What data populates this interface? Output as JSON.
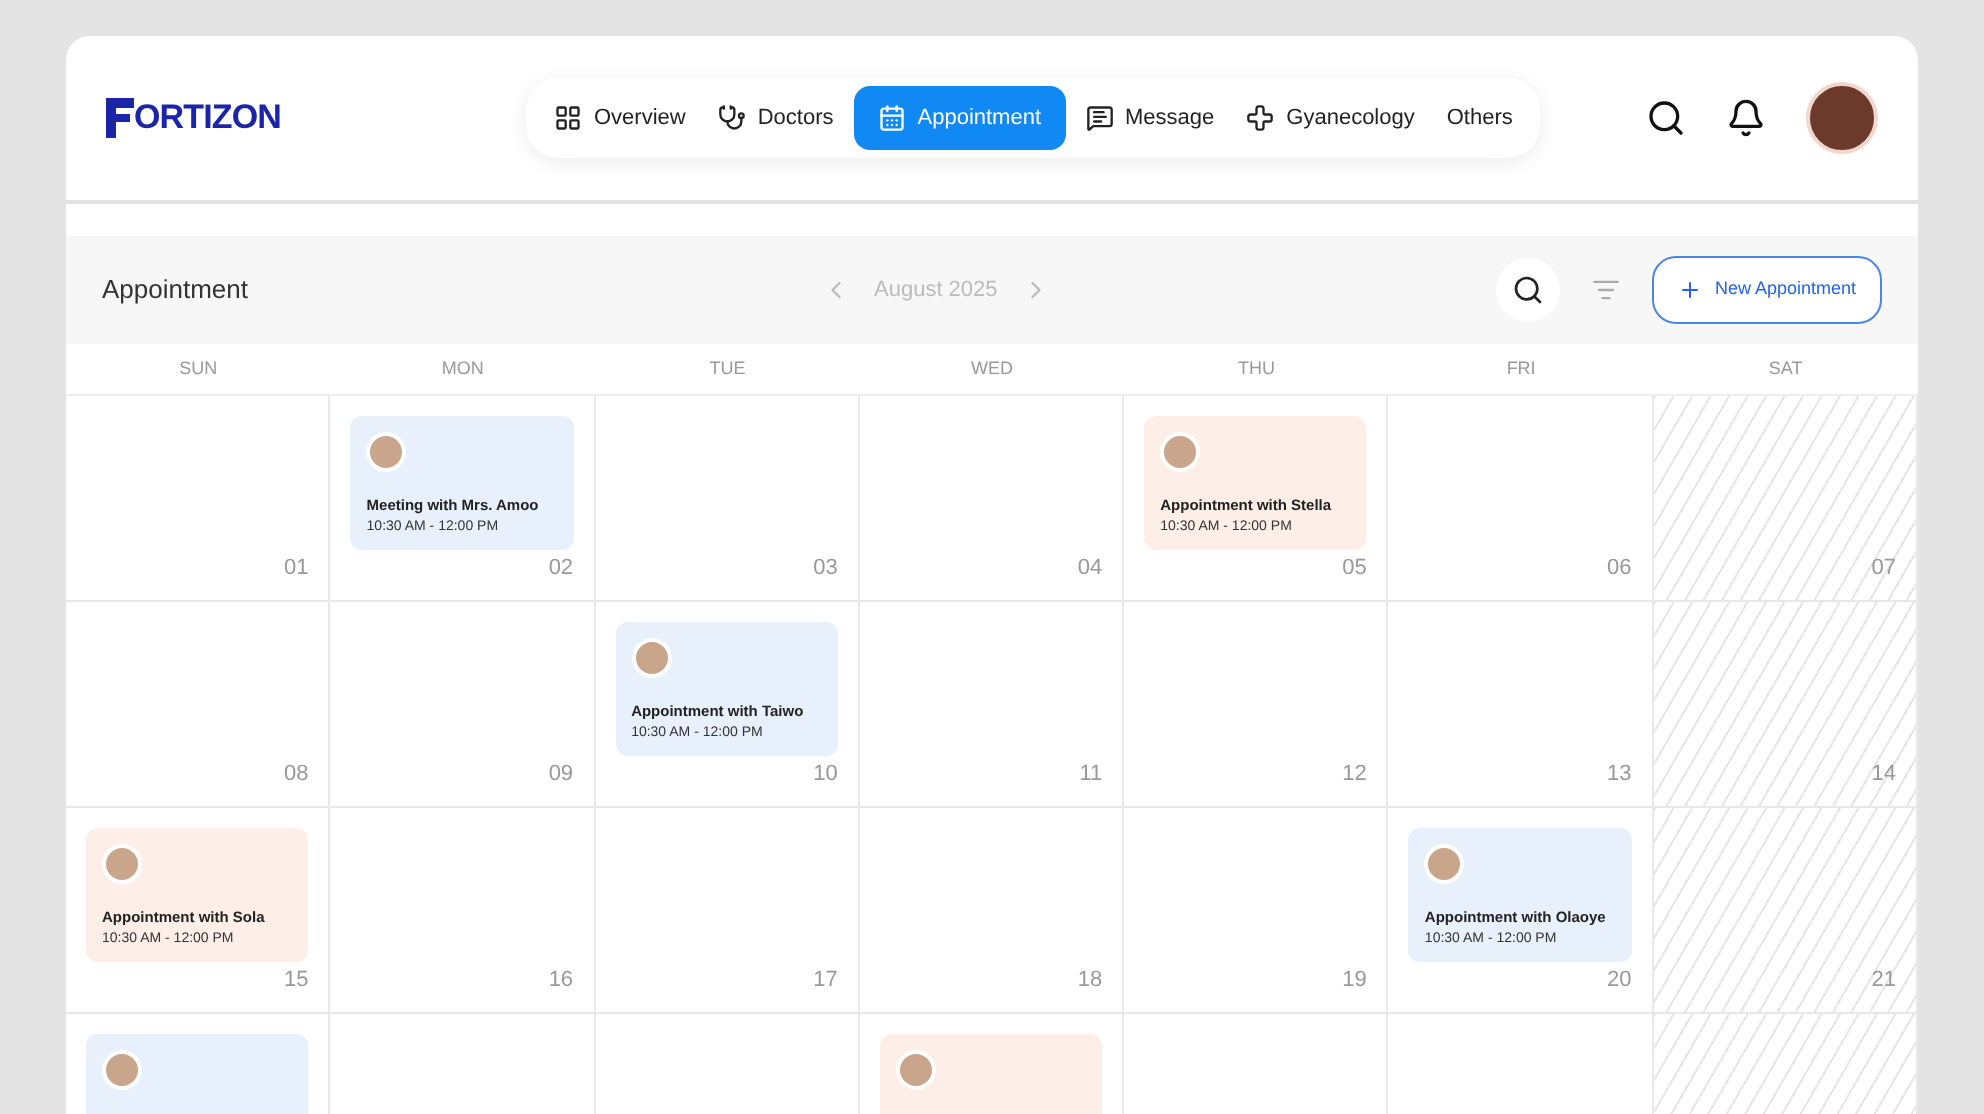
{
  "logo": {
    "text": "ORTIZON"
  },
  "nav": [
    {
      "label": "Overview",
      "selected": false
    },
    {
      "label": "Doctors",
      "selected": false
    },
    {
      "label": "Appointment",
      "selected": true
    },
    {
      "label": "Message",
      "selected": false
    },
    {
      "label": "Gyanecology",
      "selected": false
    },
    {
      "label": "Others",
      "selected": false
    }
  ],
  "toolbar": {
    "title": "Appointment",
    "month": "August 2025",
    "new_button": "New Appointment"
  },
  "weekdays": [
    "SUN",
    "MON",
    "TUE",
    "WED",
    "THU",
    "FRI",
    "SAT"
  ],
  "weeks": [
    {
      "days": [
        {
          "day": "01",
          "hatched": false
        },
        {
          "day": "02",
          "hatched": false,
          "event": {
            "title": "Meeting with Mrs. Amoo",
            "time": "10:30 AM - 12:00 PM",
            "color": "#e8f0fc"
          }
        },
        {
          "day": "03",
          "hatched": false
        },
        {
          "day": "04",
          "hatched": false
        },
        {
          "day": "05",
          "hatched": false,
          "event": {
            "title": "Appointment with Stella",
            "time": "10:30 AM - 12:00 PM",
            "color": "#fdefe7"
          }
        },
        {
          "day": "06",
          "hatched": false
        },
        {
          "day": "07",
          "hatched": true
        }
      ]
    },
    {
      "days": [
        {
          "day": "08",
          "hatched": false
        },
        {
          "day": "09",
          "hatched": false
        },
        {
          "day": "10",
          "hatched": false,
          "event": {
            "title": "Appointment with Taiwo",
            "time": "10:30 AM - 12:00 PM",
            "color": "#e8f0fc"
          }
        },
        {
          "day": "11",
          "hatched": false
        },
        {
          "day": "12",
          "hatched": false
        },
        {
          "day": "13",
          "hatched": false
        },
        {
          "day": "14",
          "hatched": true
        }
      ]
    },
    {
      "days": [
        {
          "day": "15",
          "hatched": false,
          "event": {
            "title": "Appointment with Sola",
            "time": "10:30 AM - 12:00 PM",
            "color": "#fdefe7"
          }
        },
        {
          "day": "16",
          "hatched": false
        },
        {
          "day": "17",
          "hatched": false
        },
        {
          "day": "18",
          "hatched": false
        },
        {
          "day": "19",
          "hatched": false
        },
        {
          "day": "20",
          "hatched": false,
          "event": {
            "title": "Appointment with Olaoye",
            "time": "10:30 AM - 12:00 PM",
            "color": "#e8f0fc"
          }
        },
        {
          "day": "21",
          "hatched": true
        }
      ]
    },
    {
      "days": [
        {
          "hatched": false,
          "event": {
            "color": "#e8f0fc"
          }
        },
        {
          "hatched": false
        },
        {
          "hatched": false
        },
        {
          "hatched": false,
          "event": {
            "color": "#fdefe7"
          }
        },
        {
          "hatched": false
        },
        {
          "hatched": false
        },
        {
          "hatched": true
        }
      ]
    }
  ]
}
